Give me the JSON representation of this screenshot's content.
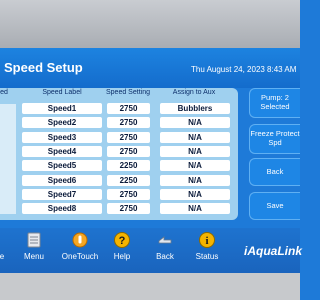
{
  "header": {
    "title": "Speed Setup",
    "datetime": "Thu August 24, 2023 8:43 AM"
  },
  "table": {
    "columns": [
      "ed",
      "Speed Label",
      "Speed Setting",
      "Assign to Aux"
    ],
    "rows": [
      {
        "label": "Speed1",
        "setting": "2750",
        "aux": "Bubblers"
      },
      {
        "label": "Speed2",
        "setting": "2750",
        "aux": "N/A"
      },
      {
        "label": "Speed3",
        "setting": "2750",
        "aux": "N/A"
      },
      {
        "label": "Speed4",
        "setting": "2750",
        "aux": "N/A"
      },
      {
        "label": "Speed5",
        "setting": "2250",
        "aux": "N/A"
      },
      {
        "label": "Speed6",
        "setting": "2250",
        "aux": "N/A"
      },
      {
        "label": "Speed7",
        "setting": "2750",
        "aux": "N/A"
      },
      {
        "label": "Speed8",
        "setting": "2750",
        "aux": "N/A"
      }
    ]
  },
  "side_buttons": {
    "pump_selected": "Pump: 2\nSelected",
    "freeze_protect": "Freeze Protect\nSpd",
    "back": "Back",
    "save": "Save"
  },
  "nav": {
    "home": "e",
    "menu": "Menu",
    "onetouch": "OneTouch",
    "help": "Help",
    "back": "Back",
    "status": "Status"
  },
  "brand": "iAquaLink",
  "colors": {
    "accent": "#1e7ad8",
    "table_bg": "#9fd0ef",
    "help_icon": "#f5b400"
  }
}
